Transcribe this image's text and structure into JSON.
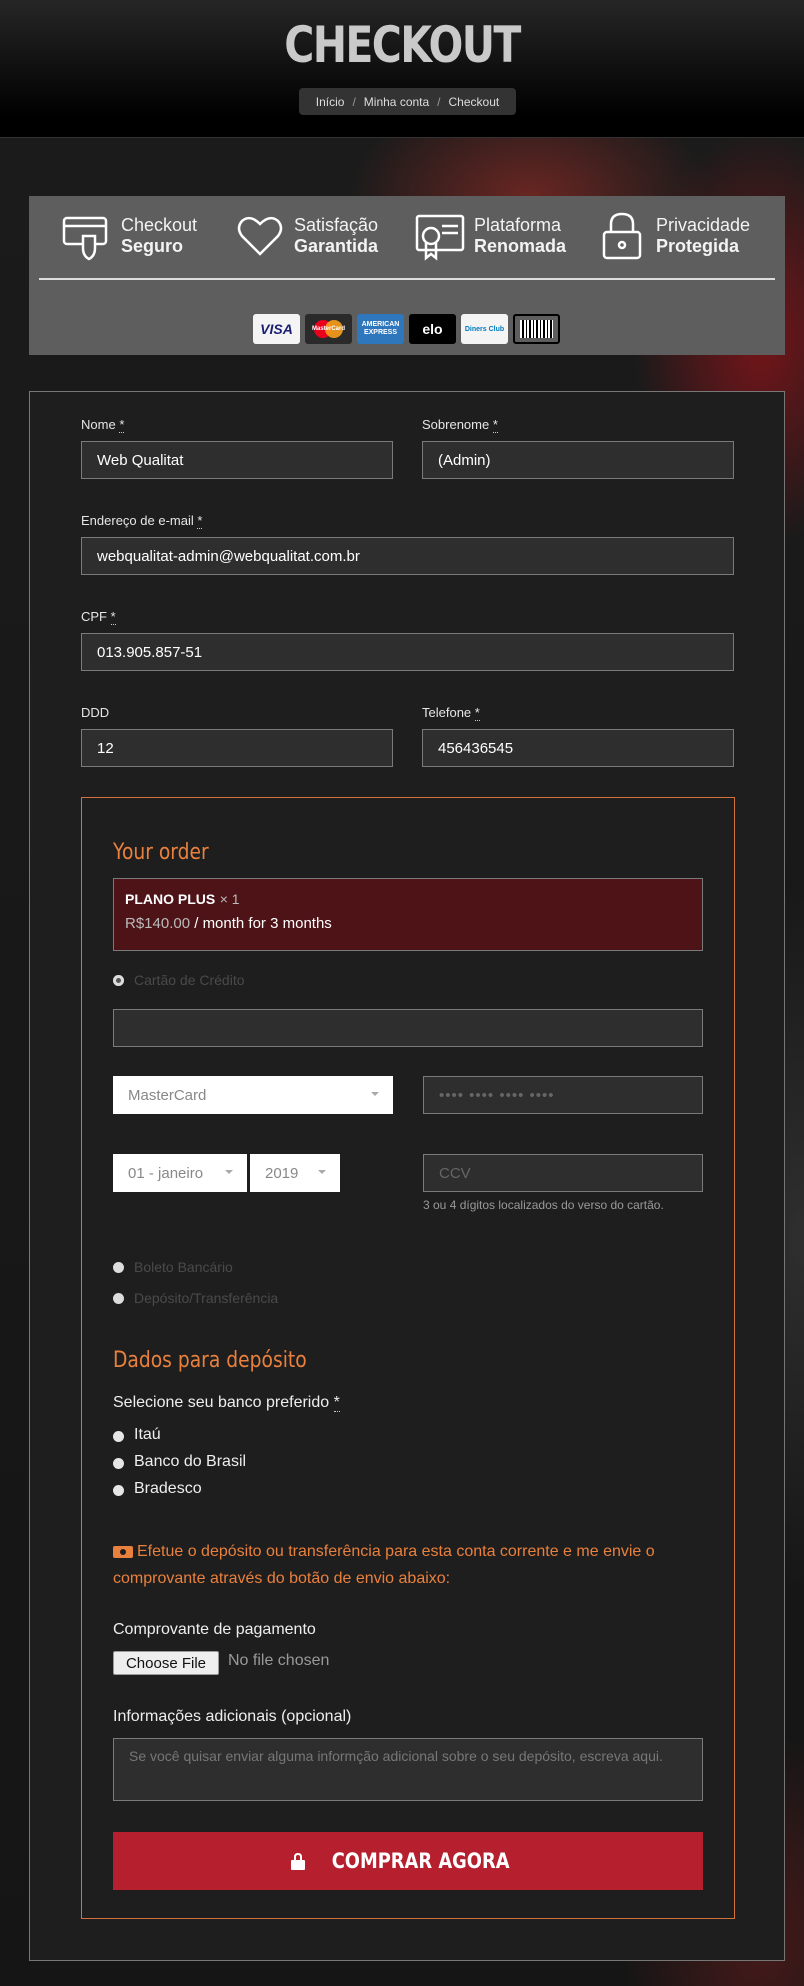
{
  "header": {
    "title": "CHECKOUT",
    "breadcrumb": [
      "Início",
      "Minha conta",
      "Checkout"
    ]
  },
  "trust": {
    "items": [
      {
        "line1": "Checkout",
        "line2": "Seguro",
        "icon": "card-shield-icon"
      },
      {
        "line1": "Satisfação",
        "line2": "Garantida",
        "icon": "heart-icon"
      },
      {
        "line1": "Plataforma",
        "line2": "Renomada",
        "icon": "certificate-icon"
      },
      {
        "line1": "Privacidade",
        "line2": "Protegida",
        "icon": "lock-icon"
      }
    ],
    "cards": [
      {
        "name": "VISA",
        "bg": "#f4f4f4",
        "fg": "#1a1f71"
      },
      {
        "name": "MasterCard",
        "bg": "#2a2a2a",
        "fg": "#f79e1b"
      },
      {
        "name": "AMERICAN EXPRESS",
        "bg": "#2e77bc",
        "fg": "#ffffff"
      },
      {
        "name": "elo",
        "bg": "#000000",
        "fg": "#ffffff"
      },
      {
        "name": "Diners Club",
        "bg": "#f4f4f4",
        "fg": "#0079be"
      },
      {
        "name": "boleto",
        "bg": "#ffffff",
        "fg": "#000000"
      }
    ]
  },
  "form": {
    "first_name": {
      "label": "Nome",
      "value": "Web Qualitat"
    },
    "last_name": {
      "label": "Sobrenome",
      "value": "(Admin)"
    },
    "email": {
      "label": "Endereço de e-mail",
      "value": "webqualitat-admin@webqualitat.com.br"
    },
    "cpf": {
      "label": "CPF",
      "value": "013.905.857-51"
    },
    "ddd": {
      "label": "DDD",
      "value": "12"
    },
    "phone": {
      "label": "Telefone",
      "value": "456436545"
    },
    "required_mark": "*"
  },
  "order": {
    "title": "Your order",
    "product_name": "PLANO PLUS",
    "product_qty": "× 1",
    "price_amount": "R$140.00",
    "price_suffix": " / month for 3 months",
    "payment": {
      "credit_card_label": "Cartão de Crédito",
      "card_brand_selected": "MasterCard",
      "card_number_placeholder": "•••• •••• •••• ••••",
      "exp_month_selected": "01 - janeiro",
      "exp_year_selected": "2019",
      "ccv_placeholder": "CCV",
      "ccv_hint": "3 ou 4 dígitos localizados do verso do cartão.",
      "boleto_label": "Boleto Bancário",
      "deposit_label": "Depósito/Transferência"
    },
    "deposit": {
      "title": "Dados para depósito",
      "bank_prompt": "Selecione seu banco preferido",
      "banks": [
        "Itaú",
        "Banco do Brasil",
        "Bradesco"
      ],
      "notice": "Efetue o depósito ou transferência para esta conta corrente e me envie o comprovante através do botão de envio abaixo:",
      "receipt_label": "Comprovante de pagamento",
      "file_button": "Choose File",
      "file_status": "No file chosen",
      "extra_label": "Informações adicionais (opcional)",
      "extra_placeholder": "Se você quisar enviar alguma informção adicional sobre o seu depósito, escreva aqui."
    },
    "buy_button": "COMPRAR AGORA"
  },
  "colors": {
    "accent": "#e9803d",
    "buy_button": "#b51f2e",
    "product_bg": "#4d1317"
  }
}
